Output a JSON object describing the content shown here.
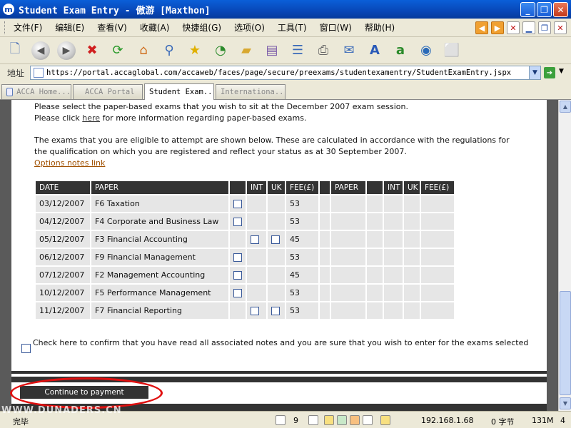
{
  "window": {
    "title": "Student Exam Entry - 傲游 [Maxthon]",
    "buttons": [
      "_",
      "❐",
      "✕"
    ]
  },
  "menubar": {
    "items": [
      "文件(F)",
      "编辑(E)",
      "查看(V)",
      "收藏(A)",
      "快捷组(G)",
      "选项(O)",
      "工具(T)",
      "窗口(W)",
      "帮助(H)"
    ]
  },
  "addressbar": {
    "label": "地址",
    "url": "https://portal.accaglobal.com/accaweb/faces/page/secure/preexams/studentexamentry/StudentExamEntry.jspx"
  },
  "tabs": [
    {
      "label": "ACCA Home..."
    },
    {
      "label": "ACCA Portal"
    },
    {
      "label": "Student Exam..."
    },
    {
      "label": "Internationa..."
    }
  ],
  "page": {
    "intro_line1": "Please select the paper-based exams that you wish to sit at the December 2007 exam session.",
    "intro_line2_pre": "Please click ",
    "intro_line2_link": "here",
    "intro_line2_post": " for more information regarding paper-based exams.",
    "eligible_line1": "The exams that you are eligible to attempt are shown below. These are calculated in accordance with the regulations for",
    "eligible_line2": "the qualification on which you are registered and reflect your status as at 30 September 2007.",
    "options_link": "Options notes link",
    "table_headers": [
      "DATE",
      "PAPER",
      "",
      "INT",
      "UK",
      "FEE(£)",
      "",
      "PAPER",
      "",
      "INT",
      "UK",
      "FEE(£)"
    ],
    "rows": [
      {
        "date": "03/12/2007",
        "paper": "F6 Taxation",
        "fee": "53"
      },
      {
        "date": "04/12/2007",
        "paper": "F4 Corporate and Business Law",
        "fee": "53"
      },
      {
        "date": "05/12/2007",
        "paper": "F3 Financial Accounting",
        "fee": "45"
      },
      {
        "date": "06/12/2007",
        "paper": "F9 Financial Management",
        "fee": "53"
      },
      {
        "date": "07/12/2007",
        "paper": "F2 Management Accounting",
        "fee": "45"
      },
      {
        "date": "10/12/2007",
        "paper": "F5 Performance Management",
        "fee": "53"
      },
      {
        "date": "11/12/2007",
        "paper": "F7 Financial Reporting",
        "fee": "53"
      }
    ],
    "confirm_text": "Check here to confirm that you have read all associated notes and you are sure that you wish to enter for the exams selected",
    "continue_label": "Continue to payment"
  },
  "statusbar": {
    "status": "完毕",
    "count": "9",
    "ip": "192.168.1.68",
    "bytes": "0 字节",
    "memory": "131M",
    "last": "4"
  },
  "watermark": "WWW.DUNADERS.CN",
  "colors": {
    "titlebar": "#0847b8",
    "table_header": "#333333",
    "table_cell": "#e6e6e6",
    "highlight_ellipse": "#e01010"
  }
}
